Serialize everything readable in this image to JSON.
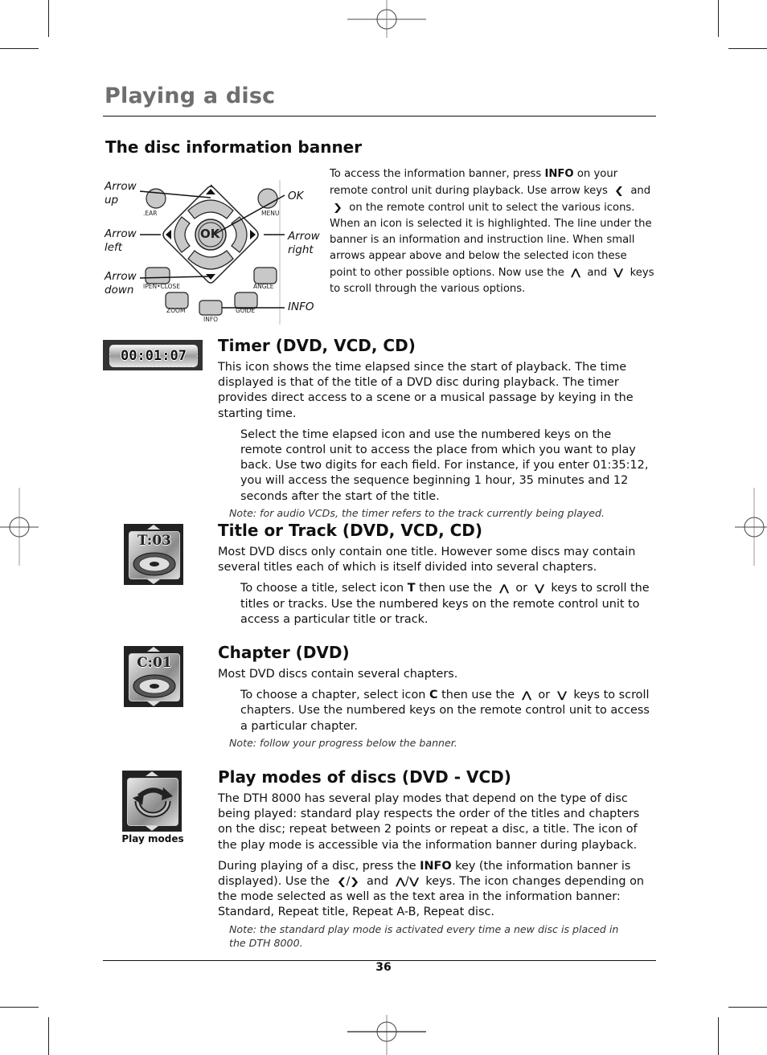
{
  "page": {
    "title": "Playing a disc",
    "page_number": "36"
  },
  "banner_section": {
    "heading": "The disc information banner",
    "diagram": {
      "labels": {
        "arrow_up": [
          "Arrow",
          "up"
        ],
        "arrow_left": [
          "Arrow",
          "left"
        ],
        "arrow_down": [
          "Arrow",
          "down"
        ],
        "ok": "OK",
        "arrow_right": [
          "Arrow",
          "right"
        ],
        "info": "INFO"
      },
      "button_captions": {
        "clear": ".EAR",
        "menu": "MENU",
        "open_close": "IPEN•CLOSE",
        "angle": "ANGLE",
        "zoom": "ZOOM",
        "guide": "GUIDE",
        "info": "INFO",
        "ok": "OK"
      }
    },
    "text_parts": {
      "p1a": "To access the information banner, press ",
      "p1_kw": "INFO",
      "p1b": " on your remote control unit during playback. Use arrow keys ",
      "p1c": " and ",
      "p1d": " on the remote control unit to select the various icons. When an icon is selected it is highlighted. The line under the banner is an information and instruction line. When small arrows appear above and below the selected icon these point to other possible options. Now use the ",
      "p1e": " and ",
      "p1f": " keys to scroll through the various options."
    }
  },
  "glyphs": {
    "left": "❮",
    "right": "❯",
    "up": "⋀",
    "down": "⋁"
  },
  "sections": {
    "timer": {
      "icon_text": "00:01:07",
      "heading": "Timer (DVD, VCD, CD)",
      "body": "This icon shows the time elapsed since the start of playback. The time displayed is that of the title of a DVD disc during playback. The timer provides direct access to a scene or a musical passage by keying in the starting time.",
      "indented": "Select the time elapsed icon and use the numbered keys on the remote control unit to access the place from which you want to play back. Use two digits for each field. For instance, if you enter 01:35:12, you will access the sequence beginning 1 hour, 35 minutes and 12 seconds after the start of the title.",
      "note": "Note: for audio VCDs, the timer refers to the track currently being played."
    },
    "title_track": {
      "icon_text": "T:03",
      "heading": "Title or Track (DVD, VCD, CD)",
      "body": "Most DVD discs only contain one title. However some discs may contain several titles each of which is itself divided into several chapters.",
      "indented_a": "To choose a title, select icon ",
      "indented_kw": "T",
      "indented_b": " then use the ",
      "indented_c": " or ",
      "indented_d": " keys to scroll the titles or tracks. Use the numbered keys on the remote control unit to access a particular title or track."
    },
    "chapter": {
      "icon_text": "C:01",
      "heading": "Chapter (DVD)",
      "body": "Most DVD discs contain several chapters.",
      "indented_a": "To choose a chapter, select icon ",
      "indented_kw": "C",
      "indented_b": " then use the ",
      "indented_c": " or ",
      "indented_d": " keys to scroll chapters. Use the numbered keys on the remote control unit to access a particular chapter.",
      "note": "Note: follow your progress below the banner."
    },
    "play_modes": {
      "icon_caption": "Play modes",
      "heading": "Play modes of discs (DVD - VCD)",
      "body": "The DTH 8000 has several play modes that depend on the type of disc being played: standard play respects the order of the titles and chapters on the disc; repeat between 2 points or repeat a disc, a title. The icon of the play mode is accessible via the information banner during playback.",
      "p2a": "During playing of a disc, press the ",
      "p2_kw": "INFO",
      "p2b": " key (the information banner is displayed). Use the ",
      "p2_sep": "/",
      "p2c": " and ",
      "p2d": " keys. The icon changes depending on the mode selected as well as the text area in the information banner: Standard, Repeat title, Repeat A-B, Repeat disc.",
      "note": "Note: the standard play mode is activated every time a new disc is placed in the DTH 8000."
    }
  }
}
